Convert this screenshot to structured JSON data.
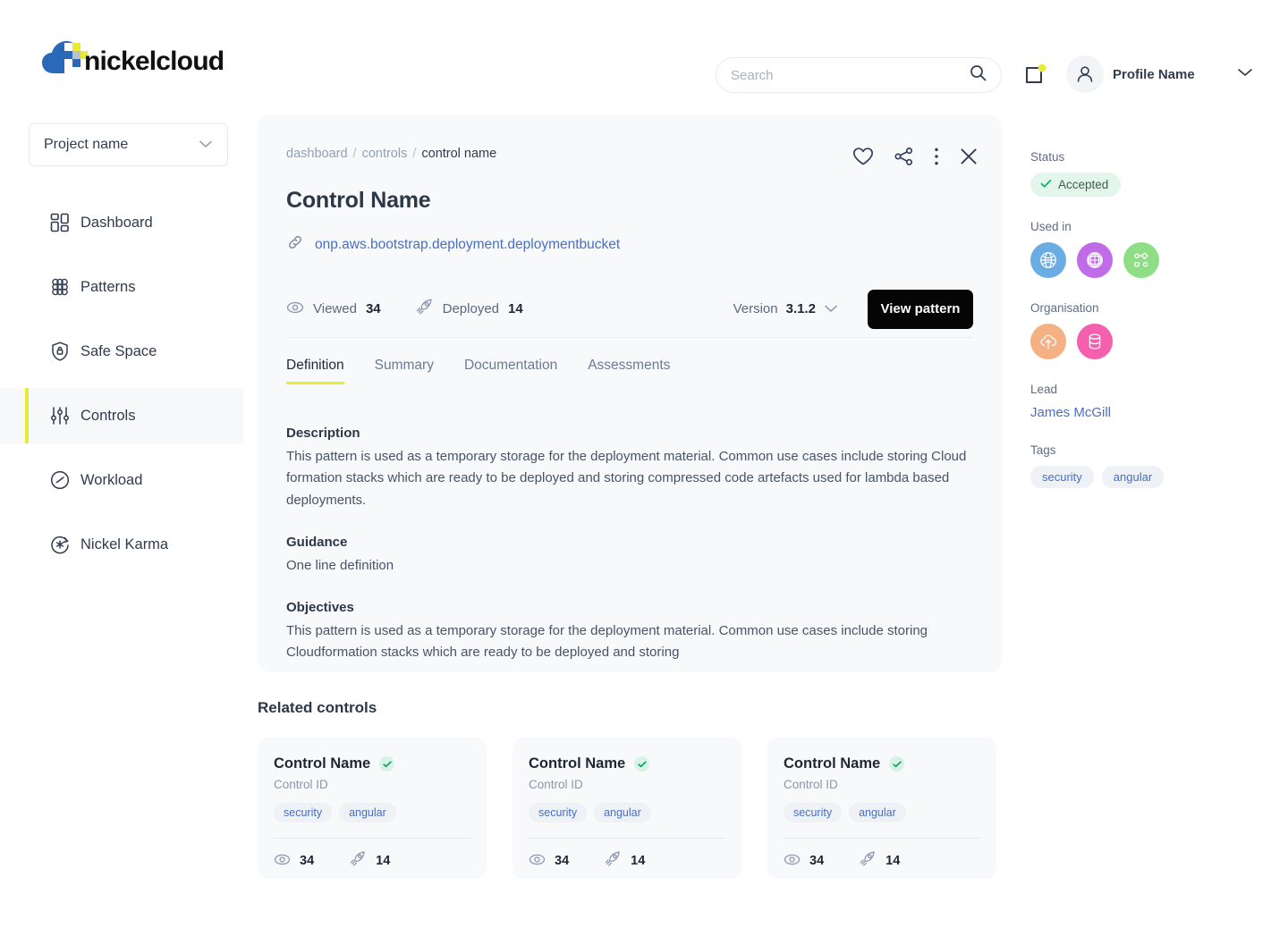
{
  "brand": {
    "name": "nickelcloud",
    "logo_icon": "cloud-pixel-logo"
  },
  "header": {
    "search": {
      "placeholder": "Search",
      "value": "",
      "icon": "search-icon"
    },
    "notifications_icon": "notifications-icon",
    "profile": {
      "name": "Profile Name",
      "avatar_icon": "user-avatar-icon",
      "caret_icon": "chevron-down-icon"
    }
  },
  "sidebar": {
    "project_selector": {
      "label": "Project name",
      "caret_icon": "chevron-down-icon"
    },
    "items": [
      {
        "label": "Dashboard",
        "icon": "dashboard-grid-icon",
        "active": false
      },
      {
        "label": "Patterns",
        "icon": "patterns-hex-icon",
        "active": false
      },
      {
        "label": "Safe Space",
        "icon": "shield-lock-icon",
        "active": false
      },
      {
        "label": "Controls",
        "icon": "sliders-icon",
        "active": true
      },
      {
        "label": "Workload",
        "icon": "gauge-icon",
        "active": false
      },
      {
        "label": "Nickel Karma",
        "icon": "karma-star-icon",
        "active": false
      }
    ],
    "active_accent": "#e8eb32"
  },
  "main": {
    "breadcrumb": [
      {
        "label": "dashboard",
        "current": false
      },
      {
        "label": "controls",
        "current": false
      },
      {
        "label": "control name",
        "current": true
      }
    ],
    "breadcrumb_sep": "/",
    "actions": [
      {
        "name": "favorite-button",
        "icon": "heart-icon"
      },
      {
        "name": "share-button",
        "icon": "share-icon"
      },
      {
        "name": "more-options-button",
        "icon": "kebab-menu-icon"
      },
      {
        "name": "close-button",
        "icon": "close-icon"
      }
    ],
    "title": "Control Name",
    "resource_link": {
      "text": "onp.aws.bootstrap.deployment.deploymentbucket",
      "icon": "link-icon"
    },
    "stats": [
      {
        "label": "Viewed",
        "value": "34",
        "icon": "eye-icon"
      },
      {
        "label": "Deployed",
        "value": "14",
        "icon": "rocket-icon"
      }
    ],
    "version": {
      "label": "Version",
      "value": "3.1.2",
      "caret_icon": "chevron-down-icon"
    },
    "view_pattern_label": "View pattern",
    "tabs": [
      {
        "label": "Definition",
        "active": true
      },
      {
        "label": "Summary",
        "active": false
      },
      {
        "label": "Documentation",
        "active": false
      },
      {
        "label": "Assessments",
        "active": false
      }
    ],
    "tab_accent": "#e8eb32",
    "sections": [
      {
        "heading": "Description",
        "body": "This pattern is used as a temporary storage for the deployment material. Common use cases include storing Cloud formation stacks which are ready to be deployed and storing compressed code artefacts used for lambda based deployments."
      },
      {
        "heading": "Guidance",
        "body": "One line definition"
      },
      {
        "heading": "Objectives",
        "body": "This pattern is used as a temporary storage for the deployment material. Common use cases include storing Cloudformation stacks which are ready to be deployed and storing"
      }
    ]
  },
  "right_panel": {
    "status": {
      "label": "Status",
      "value": "Accepted",
      "icon": "check-icon",
      "bg": "#e2f6ec",
      "fg": "#415a52"
    },
    "used_in": {
      "label": "Used in",
      "items": [
        {
          "icon": "globe-wireframe-icon",
          "color": "#6cace4"
        },
        {
          "icon": "sphere-mesh-icon",
          "color": "#c06ce8"
        },
        {
          "icon": "node-network-icon",
          "color": "#8ede85"
        }
      ]
    },
    "organisation": {
      "label": "Organisation",
      "items": [
        {
          "icon": "cloud-upload-icon",
          "color": "#f5b183"
        },
        {
          "icon": "database-icon",
          "color": "#f45fae"
        }
      ]
    },
    "lead": {
      "label": "Lead",
      "value": "James McGill"
    },
    "tags": {
      "label": "Tags",
      "items": [
        "security",
        "angular"
      ]
    }
  },
  "related": {
    "heading": "Related controls",
    "cards": [
      {
        "title": "Control Name",
        "verified_icon": "check-badge-icon",
        "id_label": "Control ID",
        "tags": [
          "security",
          "angular"
        ],
        "stats": [
          {
            "icon": "eye-icon",
            "value": "34"
          },
          {
            "icon": "rocket-icon",
            "value": "14"
          }
        ]
      },
      {
        "title": "Control Name",
        "verified_icon": "check-badge-icon",
        "id_label": "Control ID",
        "tags": [
          "security",
          "angular"
        ],
        "stats": [
          {
            "icon": "eye-icon",
            "value": "34"
          },
          {
            "icon": "rocket-icon",
            "value": "14"
          }
        ]
      },
      {
        "title": "Control Name",
        "verified_icon": "check-badge-icon",
        "id_label": "Control ID",
        "tags": [
          "security",
          "angular"
        ],
        "stats": [
          {
            "icon": "eye-icon",
            "value": "34"
          },
          {
            "icon": "rocket-icon",
            "value": "14"
          }
        ]
      }
    ]
  }
}
